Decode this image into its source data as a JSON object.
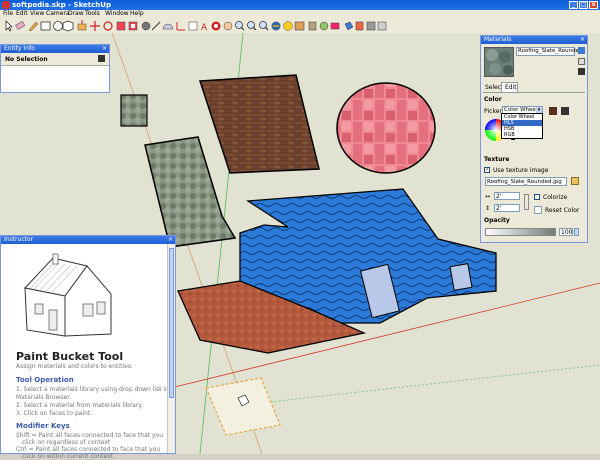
{
  "window": {
    "title": "softpedia.skp - SketchUp"
  },
  "menu": [
    "File",
    "Edit",
    "View",
    "Camera",
    "Draw",
    "Tools",
    "Window",
    "Help"
  ],
  "toolbar": {
    "icons": [
      "select-icon",
      "eraser-icon",
      "pencil-icon",
      "rectangle-icon",
      "circle-icon",
      "polygon-icon",
      "push-pull-icon",
      "move-icon",
      "rotate-icon",
      "follow-me-icon",
      "offset-icon",
      "tape-measure-icon",
      "dimension-icon",
      "protractor-icon",
      "axes-icon",
      "text-icon",
      "3d-text-icon",
      "orbit-icon",
      "pan-icon",
      "zoom-icon",
      "zoom-window-icon",
      "zoom-extents-icon",
      "previous-view-icon",
      "next-view-icon",
      "position-camera-icon",
      "walk-icon",
      "look-around-icon",
      "section-plane-icon",
      "paint-bucket-icon",
      "components-icon",
      "get-models-icon",
      "share-model-icon"
    ]
  },
  "entity_info": {
    "title": "Entity Info",
    "status": "No Selection"
  },
  "instructor": {
    "title": "Instructor",
    "tool_name": "Paint Bucket Tool",
    "tool_desc": "Assign materials and colors to entities.",
    "op_heading": "Tool Operation",
    "ops": [
      "1.  Select a materials library using drop down list in",
      "     Materials Browser.",
      "2.  Select a material from materials library.",
      "3.  Click on faces to paint."
    ],
    "mod_heading": "Modifier Keys",
    "mods": [
      "Shift = Paint all faces connected to face that you",
      "click on regardless of context",
      "Ctrl = Paint all faces connected to face that you",
      "click on within current context"
    ]
  },
  "materials": {
    "title": "Materials",
    "material_name": "Roofing_Slate_Roundec",
    "tabs": [
      "Select",
      "Edit"
    ],
    "color_heading": "Color",
    "picker_label": "Picker:",
    "picker_value": "Color Wheel",
    "picker_options": [
      "Color Wheel",
      "HLS",
      "HSB",
      "RGB"
    ],
    "picker_selected": "HLS",
    "texture_heading": "Texture",
    "use_texture_label": "Use texture image",
    "texture_file": "Roofing_Slate_Rounded.jpg",
    "width_value": "2'",
    "height_value": "2'",
    "colorize_label": "Colorize",
    "reset_color_label": "Reset Color",
    "opacity_heading": "Opacity",
    "opacity_value": "100"
  },
  "colors": {
    "title_blue": "#0a5fd8",
    "panel_blue": "#1e5fd2",
    "roof_blue": "#2b7ad8",
    "brick": "#6a4530",
    "floor": "#b55a3c",
    "stone": "#7d8c78",
    "tile": "#e07080"
  }
}
